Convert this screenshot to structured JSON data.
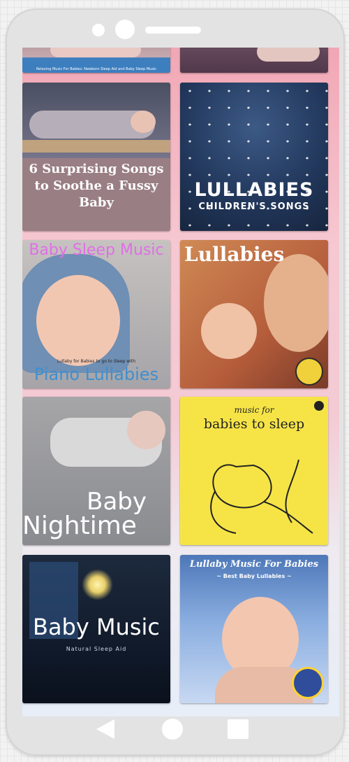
{
  "albums": [
    {
      "title": "Relaxing Music For Babies: Newborn Sleep Aid and Baby Sleep Music"
    },
    {
      "title": ""
    },
    {
      "title": "6 Surprising Songs to Soothe a Fussy Baby"
    },
    {
      "title": "LULLABIES",
      "subtitle": "CHILDREN'S SONGS"
    },
    {
      "title": "Baby Sleep Music",
      "small": "Lullaby for Babies to go to Sleep with",
      "subtitle": "Piano Lullabies"
    },
    {
      "title": "Lullabies"
    },
    {
      "title": "Baby",
      "subtitle": "Nightime"
    },
    {
      "title": "music for",
      "subtitle": "babies to sleep"
    },
    {
      "title": "Baby Music",
      "subtitle": "Natural Sleep Aid"
    },
    {
      "title": "Lullaby Music For Babies",
      "subtitle": "~ Best Baby Lullabies ~"
    }
  ],
  "nav": {
    "back": "back-icon",
    "home": "home-icon",
    "recent": "recent-apps-icon"
  },
  "colors": {
    "phone": "#e3e3e3",
    "screen_top": "#f1a7b5",
    "accent": "#e06fe6"
  }
}
